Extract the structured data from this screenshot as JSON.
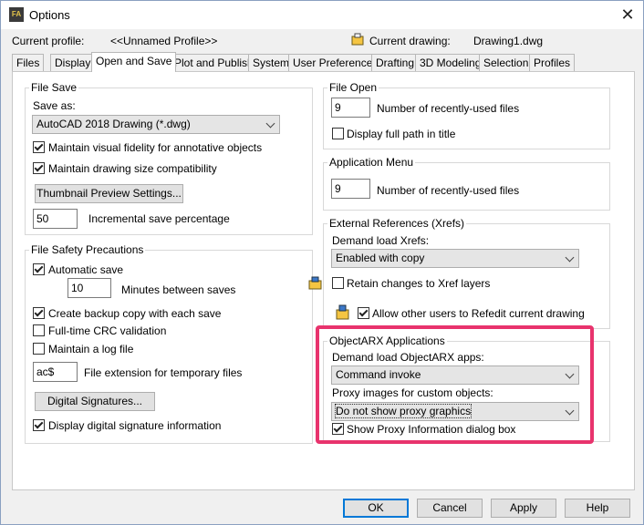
{
  "window": {
    "title": "Options"
  },
  "header": {
    "current_profile_label": "Current profile:",
    "current_profile_value": "<<Unnamed Profile>>",
    "current_drawing_label": "Current drawing:",
    "current_drawing_value": "Drawing1.dwg"
  },
  "tabs": [
    "Files",
    "Display",
    "Open and Save",
    "Plot and Publish",
    "System",
    "User Preferences",
    "Drafting",
    "3D Modeling",
    "Selection",
    "Profiles"
  ],
  "file_save": {
    "legend": "File Save",
    "save_as_label": "Save as:",
    "save_as_value": "AutoCAD 2018 Drawing (*.dwg)",
    "maintain_visual": "Maintain visual fidelity for annotative objects",
    "maintain_size": "Maintain drawing size compatibility",
    "thumbnail_button": "Thumbnail Preview Settings...",
    "incremental_value": "50",
    "incremental_label": "Incremental save percentage"
  },
  "file_safety": {
    "legend": "File Safety Precautions",
    "automatic_save": "Automatic save",
    "minutes_value": "10",
    "minutes_label": "Minutes between saves",
    "backup_copy": "Create backup copy with each save",
    "crc_validation": "Full-time CRC validation",
    "log_file": "Maintain a log file",
    "ext_value": "ac$",
    "ext_label": "File extension for temporary files",
    "digital_sig_button": "Digital Signatures...",
    "display_sig": "Display digital signature information"
  },
  "file_open": {
    "legend": "File Open",
    "recent_value": "9",
    "recent_label": "Number of recently-used files",
    "full_path": "Display full path in title"
  },
  "app_menu": {
    "legend": "Application Menu",
    "recent_value": "9",
    "recent_label": "Number of recently-used files"
  },
  "xrefs": {
    "legend": "External References (Xrefs)",
    "demand_label": "Demand load Xrefs:",
    "demand_value": "Enabled with copy",
    "retain_changes": "Retain changes to Xref layers",
    "allow_refedit": "Allow other users to Refedit current drawing"
  },
  "objectarx": {
    "legend": "ObjectARX Applications",
    "demand_label": "Demand load ObjectARX apps:",
    "demand_value": "Command invoke",
    "proxy_label": "Proxy images for custom objects:",
    "proxy_value": "Do not show proxy graphics",
    "show_proxy": "Show Proxy Information dialog box"
  },
  "buttons": {
    "ok": "OK",
    "cancel": "Cancel",
    "apply": "Apply",
    "help": "Help"
  },
  "colors": {
    "highlight": "#e8336d",
    "accent": "#0078d7"
  }
}
